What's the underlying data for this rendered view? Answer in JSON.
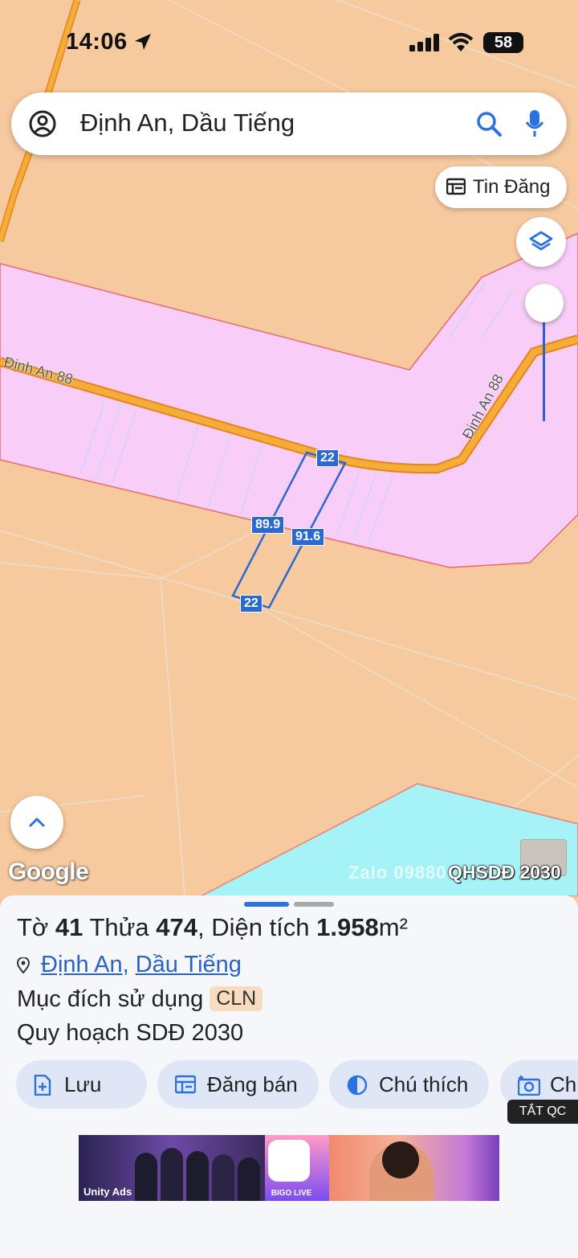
{
  "status_bar": {
    "time": "14:06",
    "battery": "58"
  },
  "search": {
    "query": "Định An, Dầu Tiếng"
  },
  "top_buttons": {
    "tin_dang": "Tin Đăng"
  },
  "map": {
    "road_labels": [
      "Định An 88",
      "Định An 88"
    ],
    "dimensions": {
      "top": "22",
      "left": "89.9",
      "right": "91.6",
      "bottom": "22"
    },
    "google_logo": "Google",
    "watermark": "Zalo 09880",
    "layer_label": "QHSDĐ 2030",
    "colors": {
      "land": "#f7c99f",
      "road_zone": "#f8cdf7",
      "road": "#f3a12b",
      "water": "#a5f3f7",
      "dim_label": "#2a6ad0"
    }
  },
  "sheet": {
    "title": {
      "sheet_prefix": "Tờ",
      "sheet_no": "41",
      "parcel_prefix": "Thửa",
      "parcel_no": "474",
      "area_prefix": "Diện tích",
      "area": "1.958",
      "area_unit": "m²"
    },
    "location": {
      "commune": "Định An",
      "district": "Dầu Tiếng"
    },
    "purpose": {
      "label": "Mục đích sử dụng",
      "code": "CLN"
    },
    "plan": "Quy hoạch SDĐ 2030",
    "actions": [
      "Lưu",
      "Đăng bán",
      "Chú thích",
      "Ch"
    ]
  },
  "ad": {
    "close_label": "TẮT QC",
    "unity": "Unity Ads",
    "bigo": "BIGO LIVE"
  }
}
